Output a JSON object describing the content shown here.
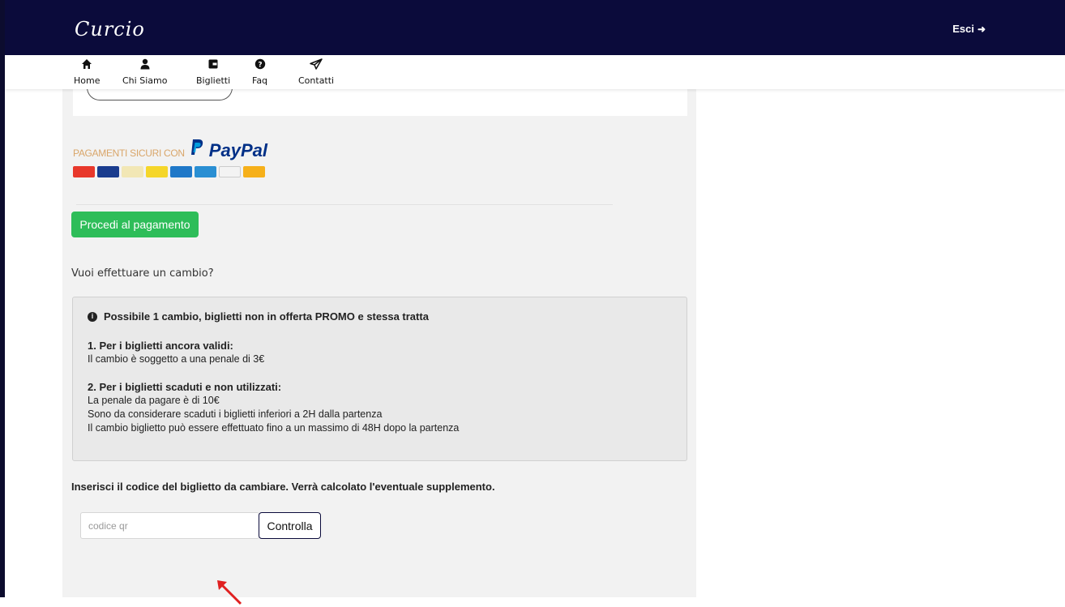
{
  "header": {
    "logo": "Curcio",
    "exit_label": "Esci"
  },
  "nav": {
    "items": [
      {
        "label": "Home",
        "icon": "home-icon"
      },
      {
        "label": "Chi Siamo",
        "icon": "user-icon"
      },
      {
        "label": "Biglietti",
        "icon": "wallet-icon"
      },
      {
        "label": "Faq",
        "icon": "question-icon"
      },
      {
        "label": "Contatti",
        "icon": "send-icon"
      }
    ]
  },
  "payment": {
    "banner_text": "PAGAMENTI SICURI CON",
    "paypal_brand": "PayPal",
    "pay_button": "Procedi al pagamento"
  },
  "change": {
    "question": "Vuoi effettuare un cambio?",
    "info_title": "Possibile 1 cambio, biglietti non in offerta PROMO e stessa tratta",
    "section1_title": "1. Per i biglietti ancora validi:",
    "section1_line1": "Il cambio è soggetto a una penale di 3€",
    "section2_title": "2. Per i biglietti scaduti e non utilizzati:",
    "section2_line1": "La penale da pagare è di 10€",
    "section2_line2": "Sono da considerare scaduti i biglietti inferiori a 2H dalla partenza",
    "section2_line3": "Il cambio biglietto può essere effettuato fino a un massimo di 48H dopo la partenza",
    "instruction": "Inserisci il codice del biglietto da cambiare. Verrà calcolato l'eventuale supplemento.",
    "input_placeholder": "codice qr",
    "check_button": "Controlla"
  },
  "colors": {
    "header_bg": "#0b0b3b",
    "pay_button": "#2ebd59",
    "arrow": "#e02020"
  }
}
